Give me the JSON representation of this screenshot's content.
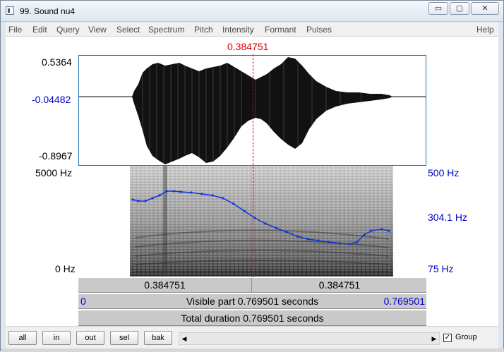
{
  "window": {
    "title": "99. Sound nu4",
    "controls": {
      "minimize": "▭",
      "maximize": "▢",
      "close": "✕"
    }
  },
  "menu": [
    "File",
    "Edit",
    "Query",
    "View",
    "Select",
    "Spectrum",
    "Pitch",
    "Intensity",
    "Formant",
    "Pulses",
    "Help"
  ],
  "cursor": {
    "time": "0.384751"
  },
  "waveform": {
    "max": "0.5364",
    "mid": "-0.04482",
    "min": "-0.8967"
  },
  "spectrogram": {
    "top_freq": "5000 Hz",
    "bottom_freq": "0 Hz"
  },
  "pitch": {
    "top": "500 Hz",
    "mid": "304.1 Hz",
    "bottom": "75 Hz"
  },
  "time_bar": {
    "left_time": "0.384751",
    "right_time": "0.384751"
  },
  "visible_bar": {
    "start": "0",
    "text": "Visible part 0.769501 seconds",
    "end": "0.769501"
  },
  "total_bar": {
    "text": "Total duration 0.769501 seconds"
  },
  "buttons": {
    "all": "all",
    "in": "in",
    "out": "out",
    "sel": "sel",
    "bak": "bak"
  },
  "group": {
    "label": "Group",
    "checked": "✓"
  },
  "scroll": {
    "left": "◀",
    "right": "▶"
  },
  "colors": {
    "pitch_line": "#1133dd",
    "cursor": "#dd0000",
    "blue_labels": "#0000cc"
  }
}
